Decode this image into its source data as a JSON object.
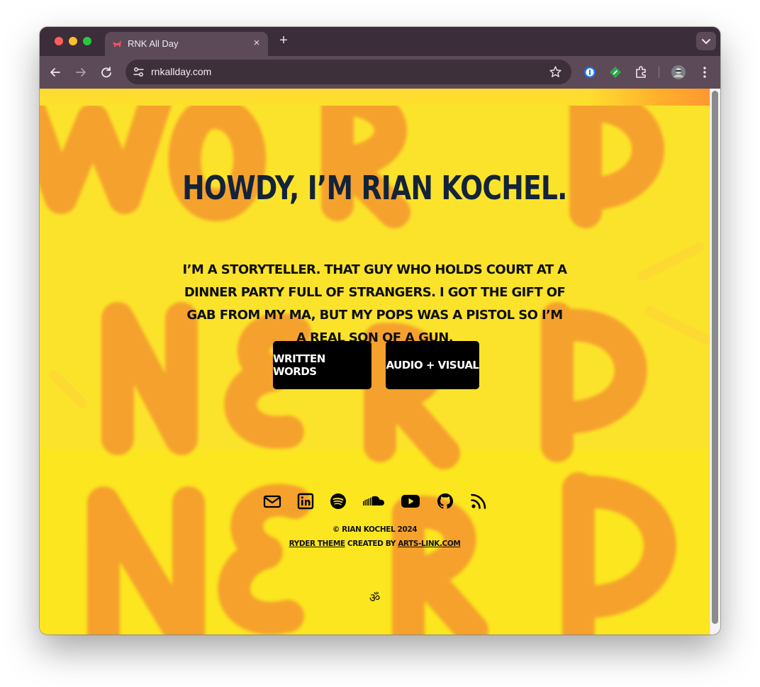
{
  "browser": {
    "tab_title": "RNK All Day",
    "new_tab_glyph": "+",
    "close_glyph": "×",
    "url": "rnkallday.com"
  },
  "colors": {
    "page_background": "#fbe21f",
    "headline": "#12233a",
    "button_background": "#000000",
    "button_text": "#ffffff",
    "chrome_frame": "#3b2d39",
    "chrome_toolbar": "#5d4a59"
  },
  "icons": {
    "toolbar": [
      "back-icon",
      "forward-icon",
      "reload-icon",
      "site-settings-icon",
      "bookmark-star-icon",
      "password-manager-extension-icon",
      "green-extension-icon",
      "extensions-puzzle-icon",
      "profile-avatar",
      "more-menu-icon"
    ],
    "social": [
      "email-icon",
      "linkedin-icon",
      "spotify-icon",
      "soundcloud-icon",
      "youtube-icon",
      "github-icon",
      "rss-icon"
    ]
  },
  "hero": {
    "headline": "Howdy, I’m Rian Kochel.",
    "intro": "I’m a storyteller. That guy who holds court at a dinner party full of strangers. I got the gift of gab from my ma, but my pops was a pistol so I’m a real son of a gun.",
    "buttons": {
      "written_words": "Written Words",
      "audio_visual": "Audio + Visual"
    }
  },
  "footer": {
    "copyright": "© Rian Kochel 2024",
    "theme_link": "Ryder Theme",
    "created_by": "created by",
    "author_link": "arts-link.com",
    "om_symbol": "ॐ"
  }
}
